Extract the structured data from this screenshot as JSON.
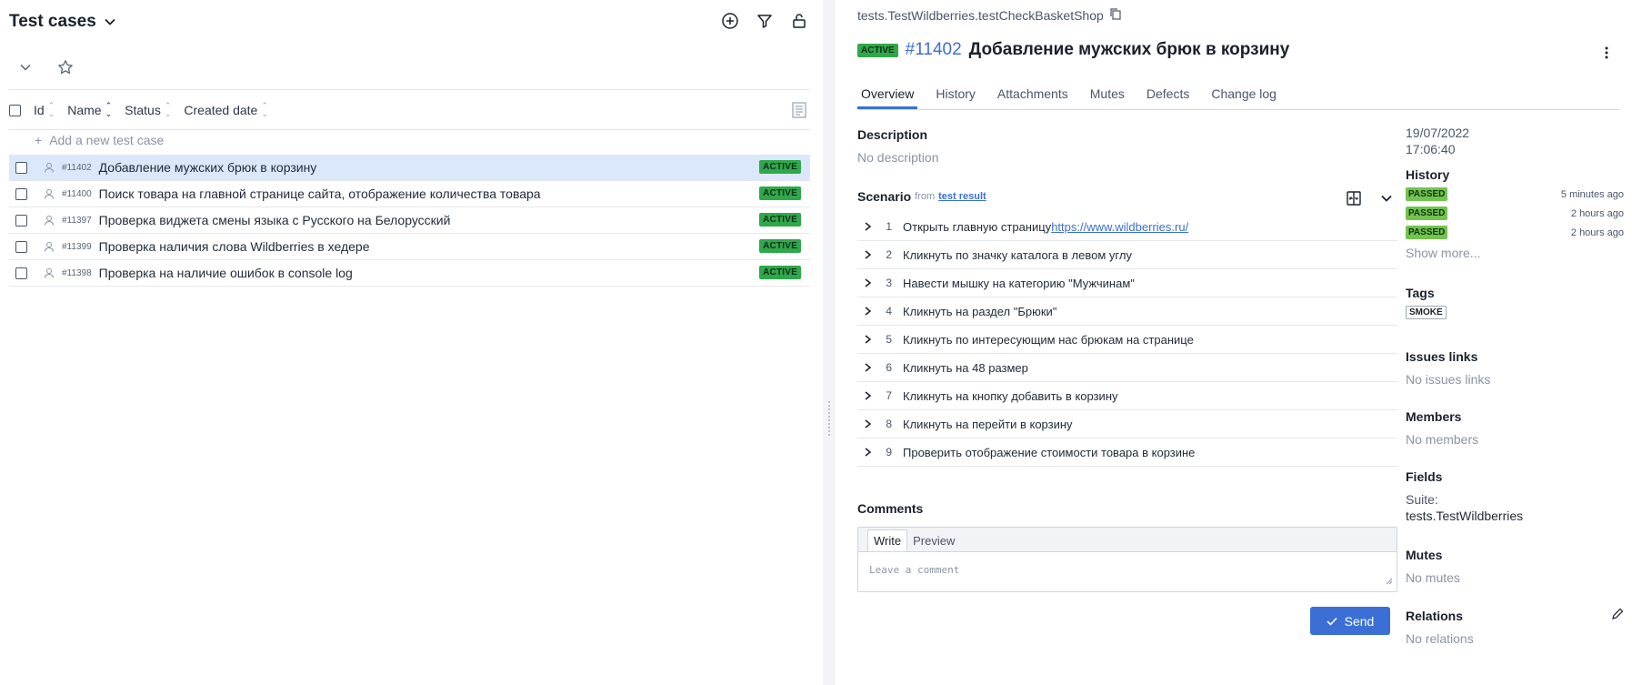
{
  "left": {
    "title": "Test cases",
    "columns": [
      "Id",
      "Name",
      "Status",
      "Created date"
    ],
    "add_label": "Add a new test case",
    "rows": [
      {
        "id": "#11402",
        "name": "Добавление мужских брюк в корзину",
        "status": "ACTIVE"
      },
      {
        "id": "#11400",
        "name": "Поиск товара на главной странице сайта, отображение количества товара",
        "status": "ACTIVE"
      },
      {
        "id": "#11397",
        "name": "Проверка виджета смены языка с Русского на Белорусский",
        "status": "ACTIVE"
      },
      {
        "id": "#11399",
        "name": "Проверка наличия слова Wildberries в хедере",
        "status": "ACTIVE"
      },
      {
        "id": "#11398",
        "name": "Проверка на наличие ошибок в console log",
        "status": "ACTIVE"
      }
    ]
  },
  "detail": {
    "path": "tests.TestWildberries.testCheckBasketShop",
    "status_badge": "ACTIVE",
    "number": "#11402",
    "name": "Добавление мужских брюк в корзину",
    "tabs": [
      "Overview",
      "History",
      "Attachments",
      "Mutes",
      "Defects",
      "Change log"
    ],
    "description_label": "Description",
    "description_value": "No description",
    "scenario_label": "Scenario",
    "scenario_from": "from",
    "scenario_link": "test result",
    "steps": [
      {
        "n": "1",
        "text": "Открыть главную страницу",
        "link": "https://www.wildberries.ru/"
      },
      {
        "n": "2",
        "text": "Кликнуть по значку каталога в левом углу",
        "link": ""
      },
      {
        "n": "3",
        "text": "Навести мышку на категорию \"Мужчинам\"",
        "link": ""
      },
      {
        "n": "4",
        "text": "Кликнуть на раздел \"Брюки\"",
        "link": ""
      },
      {
        "n": "5",
        "text": "Кликнуть по интересующим нас брюкам на странице",
        "link": ""
      },
      {
        "n": "6",
        "text": "Кликнуть на 48 размер",
        "link": ""
      },
      {
        "n": "7",
        "text": "Кликнуть на кнопку добавить в корзину",
        "link": ""
      },
      {
        "n": "8",
        "text": "Кликнуть на перейти в корзину",
        "link": ""
      },
      {
        "n": "9",
        "text": "Проверить отображение стоимости товара в корзине",
        "link": ""
      }
    ],
    "comments_label": "Comments",
    "comment_tabs": [
      "Write",
      "Preview"
    ],
    "comment_placeholder": "Leave a comment",
    "send_label": "Send"
  },
  "sidebar": {
    "date": "19/07/2022",
    "time": "17:06:40",
    "history_label": "History",
    "history": [
      {
        "status": "PASSED",
        "ago": "5 minutes ago"
      },
      {
        "status": "PASSED",
        "ago": "2 hours ago"
      },
      {
        "status": "PASSED",
        "ago": "2 hours ago"
      }
    ],
    "show_more": "Show more...",
    "tags_label": "Tags",
    "tags": [
      "SMOKE"
    ],
    "issues_label": "Issues links",
    "issues_value": "No issues links",
    "members_label": "Members",
    "members_value": "No members",
    "fields_label": "Fields",
    "fields_key": "Suite:",
    "fields_value": "tests.TestWildberries",
    "mutes_label": "Mutes",
    "mutes_value": "No mutes",
    "relations_label": "Relations",
    "relations_value": "No relations"
  },
  "colors": {
    "accent": "#3b6fd6",
    "active_badge": "#2ea84b",
    "passed_badge": "#72c44e",
    "selected_row": "#dbe8fb"
  }
}
